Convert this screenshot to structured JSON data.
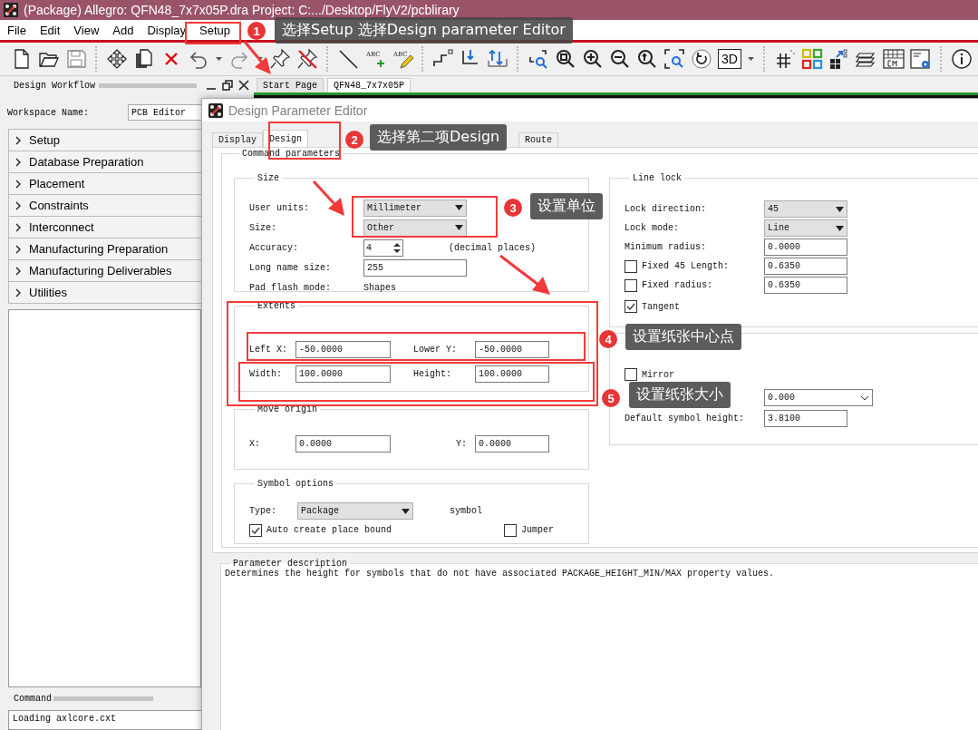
{
  "window": {
    "title": "(Package) Allegro: QFN48_7x7x05P.dra  Project: C:.../Desktop/FlyV2/pcblirary"
  },
  "menu": [
    {
      "label": "File"
    },
    {
      "label": "Edit"
    },
    {
      "label": "View"
    },
    {
      "label": "Add"
    },
    {
      "label": "Display"
    },
    {
      "label": "Setup"
    }
  ],
  "toolbar": {
    "view_mode_label": "3D",
    "add_text_icon_label": "ABC",
    "edit_text_icon_label": "ABC"
  },
  "workflow_panel": {
    "title": "Design Workflow",
    "workspace_label": "Workspace Name:",
    "workspace_value": "PCB Editor",
    "items": [
      {
        "label": "Setup",
        "expanded": false
      },
      {
        "label": "Database Preparation",
        "expanded": false
      },
      {
        "label": "Placement",
        "expanded": false
      },
      {
        "label": "Constraints",
        "expanded": false
      },
      {
        "label": "Interconnect",
        "expanded": false
      },
      {
        "label": "Manufacturing Preparation",
        "expanded": false
      },
      {
        "label": "Manufacturing Deliverables",
        "expanded": false
      },
      {
        "label": "Utilities",
        "expanded": false
      }
    ],
    "command_title": "Command",
    "command_lines": [
      "Loading axlcore.cxt"
    ]
  },
  "document_tabs": [
    {
      "label": "Start Page",
      "selected": false
    },
    {
      "label": "QFN48_7x7x05P",
      "selected": true
    }
  ],
  "dialog": {
    "title": "Design Parameter Editor",
    "tabs": [
      {
        "label": "Display",
        "selected": false
      },
      {
        "label": "Design",
        "selected": true
      },
      {
        "label": "Route",
        "selected": false
      }
    ],
    "group_title": "Command parameters",
    "size": {
      "title": "Size",
      "rows": [
        {
          "kind": "dropdown",
          "label": "User units:",
          "value": "Millimeter"
        },
        {
          "kind": "dropdown",
          "label": "Size:",
          "value": "Other"
        },
        {
          "kind": "spinner",
          "label": "Accuracy:",
          "value": "4",
          "suffix": "(decimal places)"
        },
        {
          "kind": "field",
          "label": "Long name size:",
          "value": "255"
        },
        {
          "kind": "text",
          "label": "Pad flash mode:",
          "value": "Shapes"
        }
      ]
    },
    "extents": {
      "title": "Extents",
      "fields": [
        {
          "label": "Left X:",
          "value": "-50.0000"
        },
        {
          "label": "Lower Y:",
          "value": "-50.0000"
        },
        {
          "label": "Width:",
          "value": "100.0000"
        },
        {
          "label": "Height:",
          "value": "100.0000"
        }
      ]
    },
    "move_origin": {
      "title": "Move origin",
      "fields": [
        {
          "label": "X:",
          "value": "0.0000"
        },
        {
          "label": "Y:",
          "value": "0.0000"
        }
      ]
    },
    "symbol_options": {
      "title": "Symbol options",
      "type_label": "Type:",
      "type_value": "Package",
      "type_suffix": "symbol",
      "checks": [
        {
          "label": "Auto create place bound",
          "checked": true
        },
        {
          "label": "Jumper",
          "checked": false
        }
      ]
    },
    "line_lock": {
      "title": "Line lock",
      "rows": [
        {
          "kind": "dropdown",
          "label": "Lock direction:",
          "value": "45"
        },
        {
          "kind": "dropdown",
          "label": "Lock mode:",
          "value": "Line"
        },
        {
          "kind": "field",
          "label": "Minimum radius:",
          "value": "0.0000"
        },
        {
          "kind": "checkfield",
          "label": "Fixed 45 Length:",
          "checked": false,
          "value": "0.6350"
        },
        {
          "kind": "checkfield",
          "label": "Fixed radius:",
          "checked": false,
          "value": "0.6350"
        },
        {
          "kind": "check",
          "label": "Tangent",
          "checked": true
        }
      ]
    },
    "symbol": {
      "rows": [
        {
          "kind": "check",
          "label": "Mirror",
          "checked": false
        },
        {
          "kind": "combo",
          "value": "0.000"
        },
        {
          "kind": "field",
          "label": "Default symbol height:",
          "value": "3.8100"
        }
      ]
    },
    "description": {
      "title": "Parameter description",
      "text": "Determines the height for symbols that do not have associated PACKAGE_HEIGHT_MIN/MAX property values."
    }
  },
  "annotations": [
    {
      "number": "1",
      "text": "选择Setup 选择Design parameter Editor"
    },
    {
      "number": "2",
      "text": "选择第二项Design"
    },
    {
      "number": "3",
      "text": "设置单位"
    },
    {
      "number": "4",
      "text": "设置纸张中心点"
    },
    {
      "number": "5",
      "text": "设置纸张大小"
    }
  ]
}
